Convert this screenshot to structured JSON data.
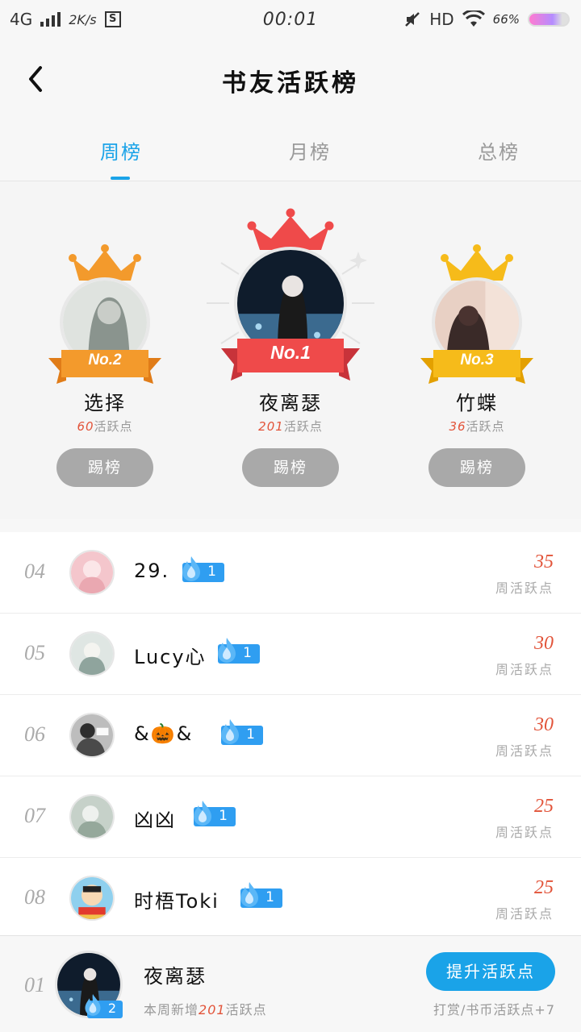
{
  "status_bar": {
    "network": "4G",
    "speed": "2K/s",
    "sim_icon": "S",
    "time": "00:01",
    "hd": "HD",
    "battery_text": "66%"
  },
  "header": {
    "title": "书友活跃榜"
  },
  "tabs": [
    {
      "label": "周榜",
      "active": true
    },
    {
      "label": "月榜",
      "active": false
    },
    {
      "label": "总榜",
      "active": false
    }
  ],
  "podium": {
    "first": {
      "rank_label": "No.1",
      "name": "夜离瑟",
      "points": "201",
      "points_unit": "活跃点",
      "button": "踢榜",
      "color": "#ef4a4a"
    },
    "second": {
      "rank_label": "No.2",
      "name": "选择",
      "points": "60",
      "points_unit": "活跃点",
      "button": "踢榜",
      "color": "#f39a2c"
    },
    "third": {
      "rank_label": "No.3",
      "name": "竹蝶",
      "points": "36",
      "points_unit": "活跃点",
      "button": "踢榜",
      "color": "#f6bb1a"
    }
  },
  "list": [
    {
      "rank": "04",
      "name": "29.",
      "level": "1",
      "score": "35",
      "unit": "周活跃点",
      "avatar_color": "#f4c6cc"
    },
    {
      "rank": "05",
      "name": "Lucy心",
      "level": "1",
      "score": "30",
      "unit": "周活跃点",
      "avatar_color": "#b8c6c2"
    },
    {
      "rank": "06",
      "name": "&🎃&",
      "level": "1",
      "score": "30",
      "unit": "周活跃点",
      "avatar_color": "#4a4a4a"
    },
    {
      "rank": "07",
      "name": "凶凶",
      "level": "1",
      "score": "25",
      "unit": "周活跃点",
      "avatar_color": "#a9b8ae"
    },
    {
      "rank": "08",
      "name": "时梧Toki",
      "level": "1",
      "score": "25",
      "unit": "周活跃点",
      "avatar_color": "#f0c24a"
    }
  ],
  "me": {
    "rank": "01",
    "name": "夜离瑟",
    "level": "2",
    "desc_prefix": "本周新增",
    "desc_points": "201",
    "desc_suffix": "活跃点",
    "boost_button": "提升活跃点",
    "boost_hint": "打赏/书币活跃点+7"
  },
  "icons": {
    "back": "chevron-left-icon",
    "crown": "crown-icon",
    "flame": "flame-icon",
    "wifi": "wifi-icon",
    "mute": "mute-icon"
  },
  "colors": {
    "accent": "#1aa3e8",
    "score": "#e2543a",
    "badge": "#2f9ef1"
  }
}
